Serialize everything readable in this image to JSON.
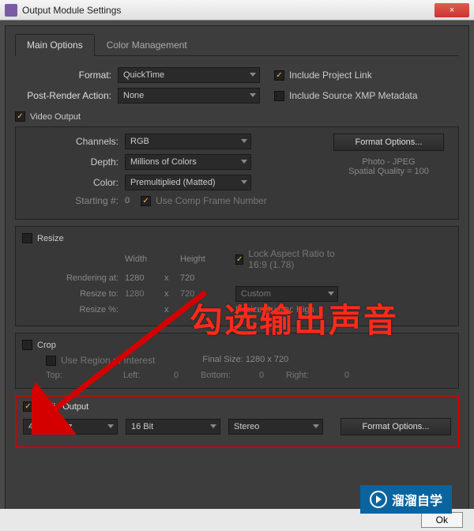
{
  "window": {
    "title": "Output Module Settings",
    "close_x": "×"
  },
  "tabs": {
    "main": "Main Options",
    "color": "Color Management"
  },
  "format": {
    "label": "Format:",
    "value": "QuickTime",
    "post_label": "Post-Render Action:",
    "post_value": "None",
    "include_link": "Include Project Link",
    "include_xmp": "Include Source XMP Metadata"
  },
  "video": {
    "head": "Video Output",
    "channels_label": "Channels:",
    "channels": "RGB",
    "depth_label": "Depth:",
    "depth": "Millions of Colors",
    "color_label": "Color:",
    "color": "Premultiplied (Matted)",
    "starting_label": "Starting #:",
    "starting": "0",
    "use_comp": "Use Comp Frame Number",
    "format_options": "Format Options...",
    "codec_line1": "Photo - JPEG",
    "codec_line2": "Spatial Quality = 100"
  },
  "resize": {
    "head": "Resize",
    "width": "Width",
    "height": "Height",
    "lock": "Lock Aspect Ratio to 16:9 (1.78)",
    "rendering_label": "Rendering at:",
    "r_w": "1280",
    "x": "x",
    "r_h": "720",
    "resize_label": "Resize to:",
    "rs_w": "1280",
    "rs_h": "720",
    "preset": "Custom",
    "pct_label": "Resize %:",
    "quality_label": "Resize Quality:",
    "quality": "High"
  },
  "crop": {
    "head": "Crop",
    "roi": "Use Region of Interest",
    "final": "Final Size: 1280 x 720",
    "top": "Top:",
    "left": "Left:",
    "bottom": "Bottom:",
    "right": "Right:",
    "zero": "0"
  },
  "audio": {
    "head": "Audio Output",
    "rate": "48.000 kHz",
    "bits": "16 Bit",
    "channels": "Stereo",
    "format_options": "Format Options..."
  },
  "annotation": "勾选输出声音",
  "logo": "溜溜自学",
  "ok": "Ok"
}
